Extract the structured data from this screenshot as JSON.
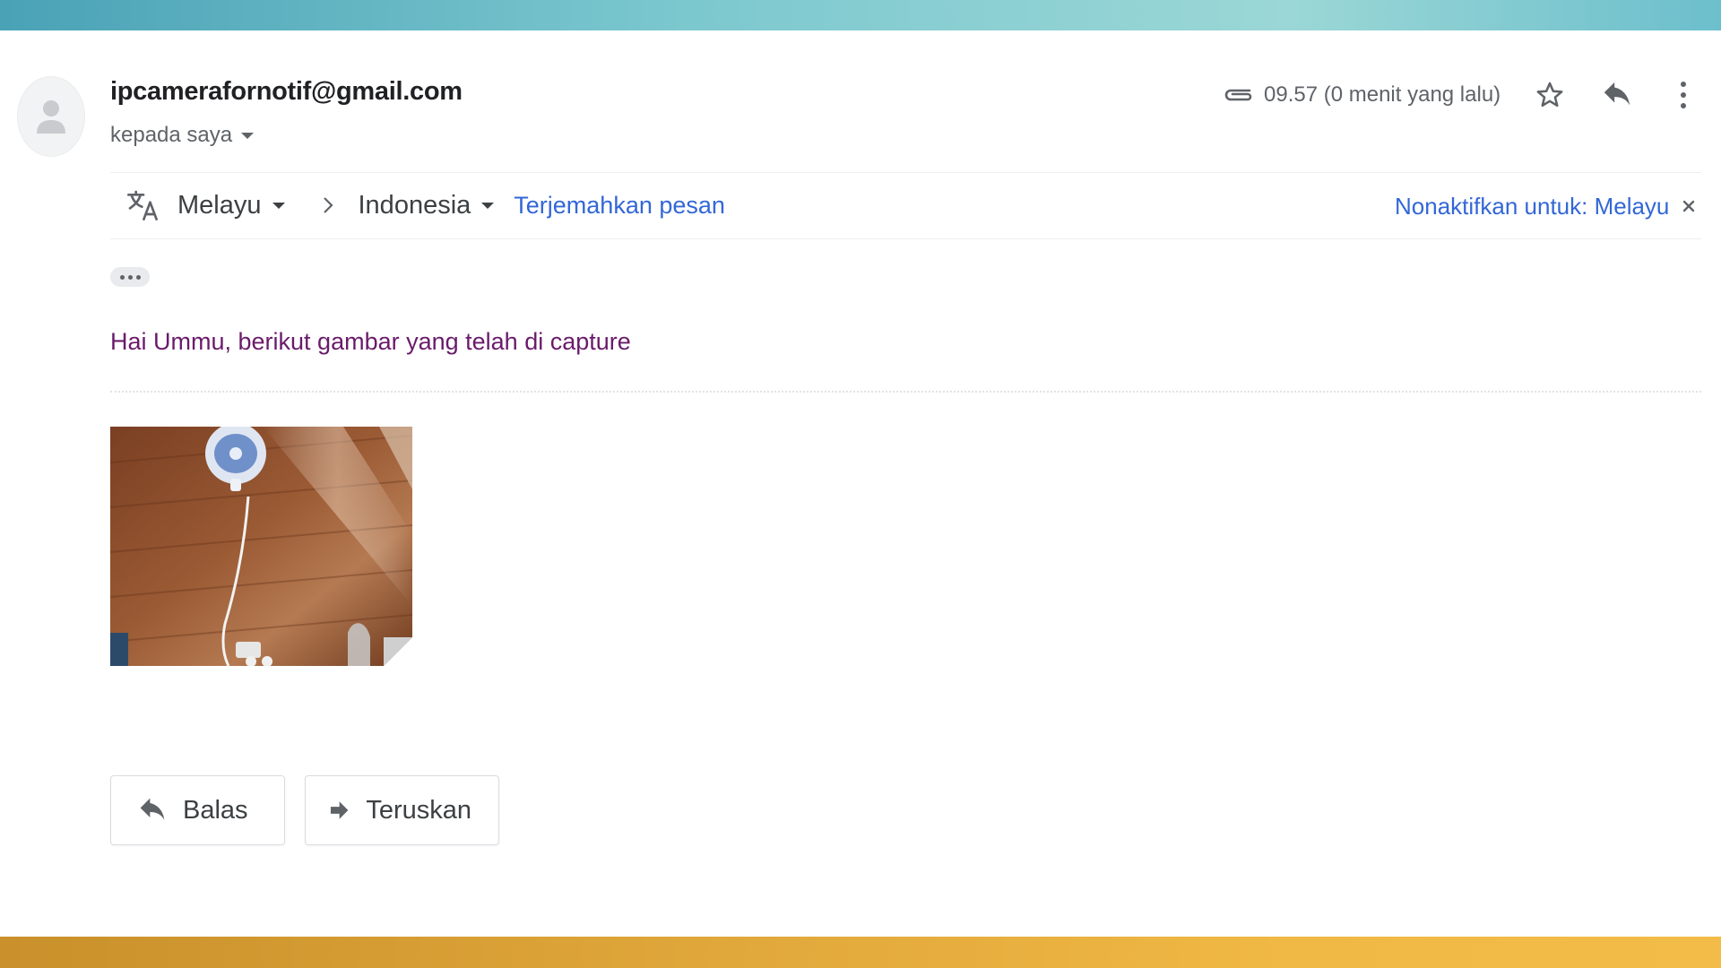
{
  "email": {
    "sender": "ipcamerafornotif@gmail.com",
    "recipient_label": "kepada saya",
    "time": "09.57 (0 menit yang lalu)",
    "body": "Hai Ummu, berikut gambar yang telah di capture"
  },
  "translation": {
    "source_lang": "Melayu",
    "target_lang": "Indonesia",
    "translate_link": "Terjemahkan pesan",
    "disable_link": "Nonaktifkan untuk: Melayu"
  },
  "actions": {
    "reply_label": "Balas",
    "forward_label": "Teruskan"
  },
  "icons": {
    "avatar": "person-icon",
    "attachment": "paperclip-icon",
    "star": "star-icon",
    "reply": "reply-icon",
    "more": "more-vert-icon",
    "translate": "translate-icon",
    "close": "close-icon",
    "forward": "forward-icon"
  },
  "colors": {
    "link": "#3367d6",
    "body_text": "#6a1b6a",
    "top_band": "#7cc8cf",
    "bottom_band": "#f0b844"
  }
}
